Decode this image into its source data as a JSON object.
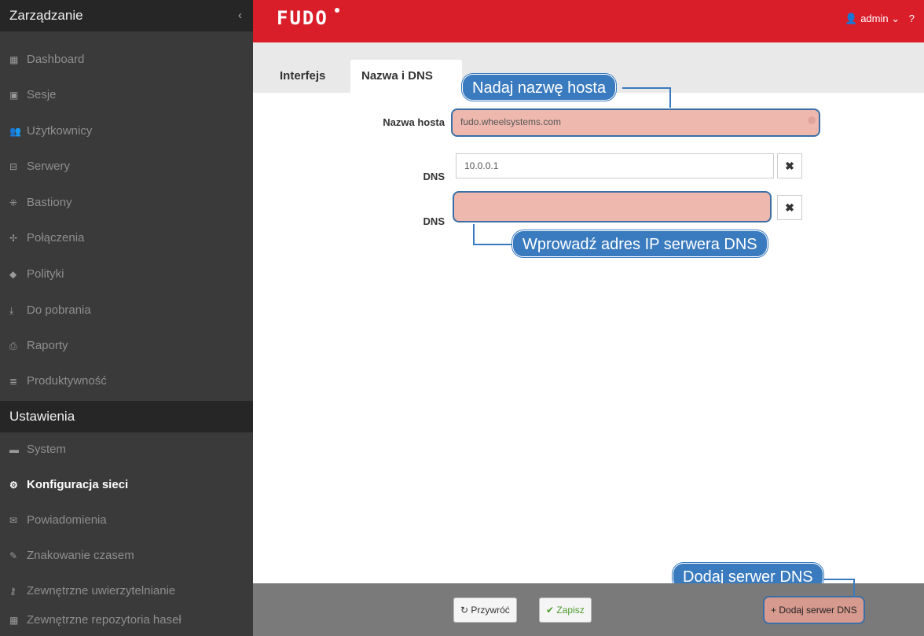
{
  "sidebar": {
    "section1_title": "Zarządzanie",
    "collapse_glyph": "‹",
    "items": [
      {
        "label": "Dashboard",
        "icon": "dashboard-icon",
        "glyph": "▦"
      },
      {
        "label": "Sesje",
        "icon": "sessions-icon",
        "glyph": "▣"
      },
      {
        "label": "Użytkownicy",
        "icon": "users-icon",
        "glyph": "👥"
      },
      {
        "label": "Serwery",
        "icon": "server-icon",
        "glyph": "⊟"
      },
      {
        "label": "Bastiony",
        "icon": "bastion-icon",
        "glyph": "⁜"
      },
      {
        "label": "Połączenia",
        "icon": "connections-icon",
        "glyph": "✢"
      },
      {
        "label": "Polityki",
        "icon": "shield-icon",
        "glyph": "◆"
      },
      {
        "label": "Do pobrania",
        "icon": "download-icon",
        "glyph": "⤓"
      },
      {
        "label": "Raporty",
        "icon": "printer-icon",
        "glyph": "⎙"
      },
      {
        "label": "Produktywność",
        "icon": "productivity-icon",
        "glyph": "≣"
      }
    ],
    "section2_title": "Ustawienia",
    "settings_items": [
      {
        "label": "System",
        "icon": "folder-icon",
        "glyph": "▬"
      },
      {
        "label": "Konfiguracja sieci",
        "icon": "cogs-icon",
        "glyph": "⚙",
        "active": true
      },
      {
        "label": "Powiadomienia",
        "icon": "envelope-icon",
        "glyph": "✉"
      },
      {
        "label": "Znakowanie czasem",
        "icon": "edit-icon",
        "glyph": "✎"
      },
      {
        "label": "Zewnętrzne uwierzytelnianie",
        "icon": "key-icon",
        "glyph": "⚷"
      },
      {
        "label": "Zewnętrzne repozytoria haseł",
        "icon": "grid-icon",
        "glyph": "▦"
      }
    ]
  },
  "topbar": {
    "logo": "FUDO",
    "user_glyph": "👤",
    "user": "admin",
    "user_chevron": "⌄",
    "help": "?"
  },
  "tabs": [
    "Interfejs",
    "Nazwa i DNS"
  ],
  "form": {
    "hostname_label": "Nazwa hosta",
    "hostname_value": "fudo.wheelsystems.com",
    "dns_label": "DNS",
    "dns1_value": "10.0.0.1",
    "dns2_value": "",
    "remove_glyph": "✖"
  },
  "callouts": {
    "hostname": "Nadaj nazwę hosta",
    "dns": "Wprowadź adres IP serwera DNS",
    "add_dns": "Dodaj serwer DNS"
  },
  "footer": {
    "restore_glyph": "↻",
    "restore": "Przywróć",
    "save_glyph": "✔",
    "save": "Zapisz",
    "add_glyph": "+",
    "add_dns": "Dodaj serwer DNS"
  },
  "colors": {
    "brand_red": "#d91e2a",
    "callout_blue": "#3a7bbf",
    "highlight_fill": "#eeb8ae",
    "sidebar_bg": "#3a3a3a"
  }
}
